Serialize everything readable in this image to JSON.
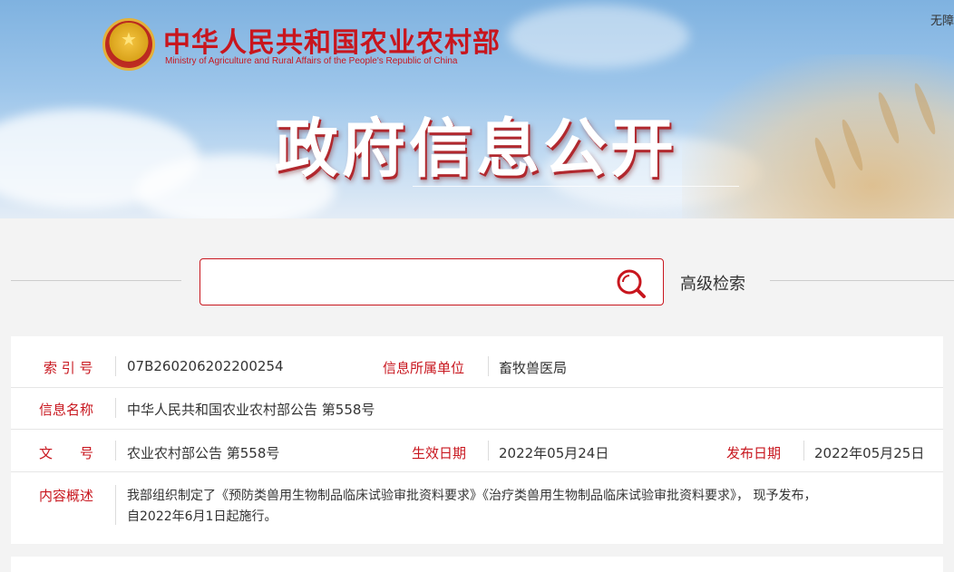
{
  "header": {
    "ministry_cn": "中华人民共和国农业农村部",
    "ministry_en": "Ministry of Agriculture and Rural Affairs of the People's Republic of China",
    "top_link": "无障",
    "banner_title": "政府信息公开"
  },
  "search": {
    "placeholder": "",
    "advanced_label": "高级检索"
  },
  "info": {
    "index_label": "索 引 号",
    "index_value": "07B260206202200254",
    "unit_label": "信息所属单位",
    "unit_value": "畜牧兽医局",
    "name_label": "信息名称",
    "name_value": "中华人民共和国农业农村部公告 第558号",
    "doc_label": "文　　号",
    "doc_value": "农业农村部公告 第558号",
    "effective_label": "生效日期",
    "effective_value": "2022年05月24日",
    "publish_label": "发布日期",
    "publish_value": "2022年05月25日",
    "summary_label": "内容概述",
    "summary_line1": "我部组织制定了《预防类兽用生物制品临床试验审批资料要求》《治疗类兽用生物制品临床试验审批资料要求》， 现予发布，",
    "summary_line2": "自2022年6月1日起施行。"
  },
  "colors": {
    "brand_red": "#c8161e",
    "text": "#333333"
  }
}
